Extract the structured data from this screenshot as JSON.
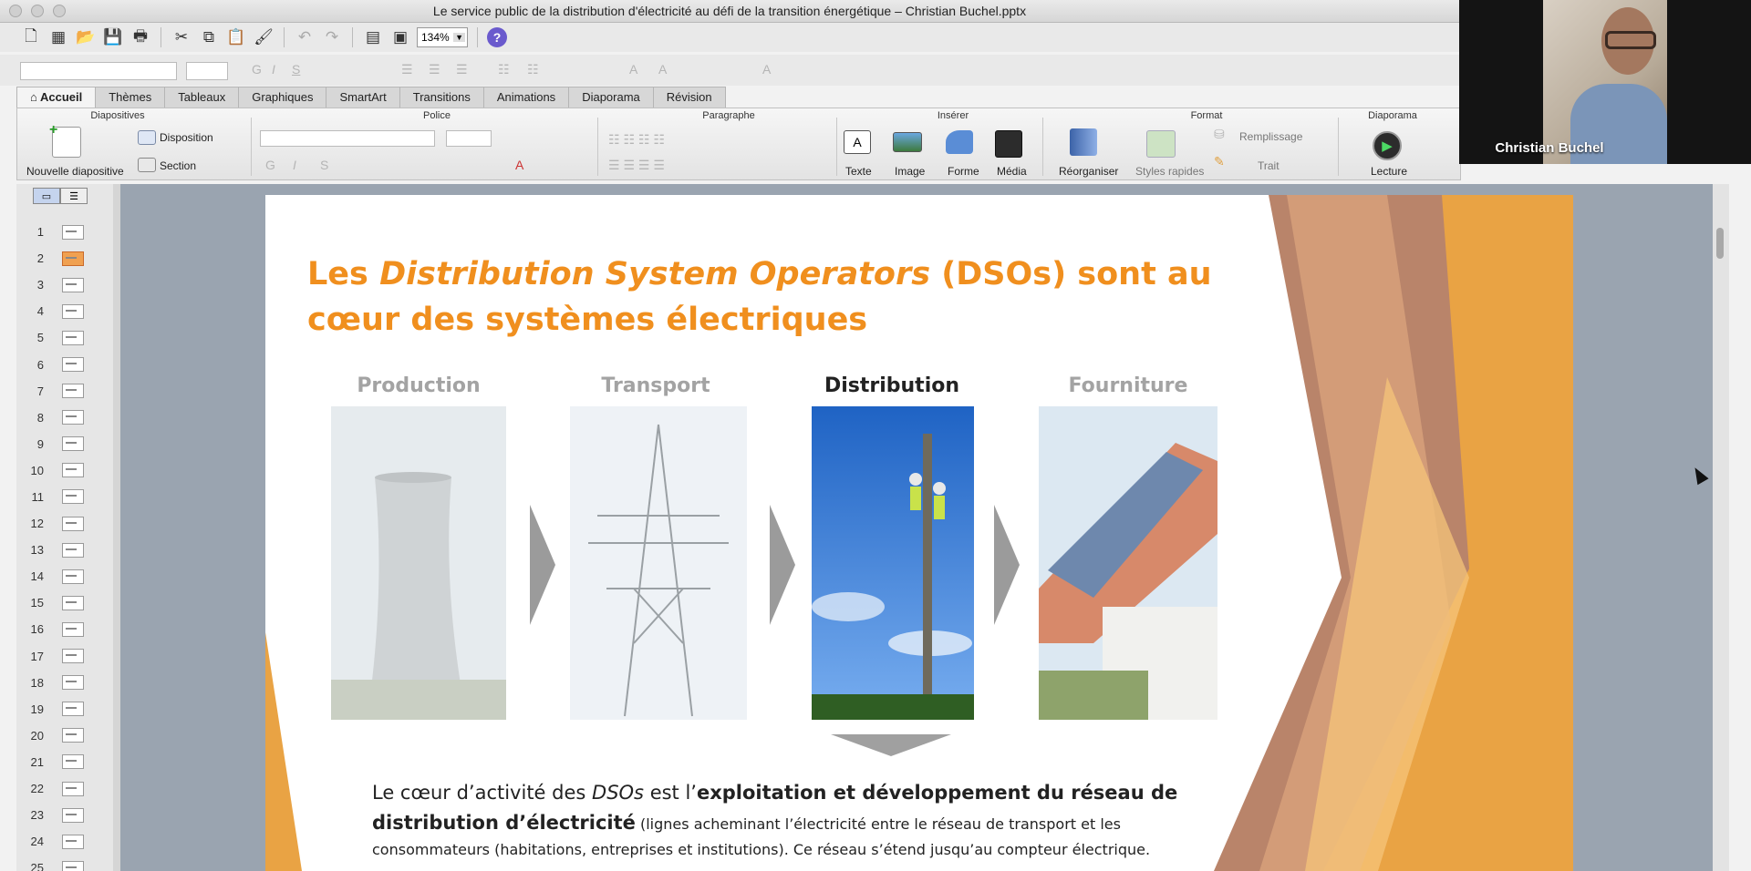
{
  "window": {
    "title": "Le service public de la distribution d'électricité au défi de la transition énergétique – Christian Buchel.pptx"
  },
  "toolbar": {
    "zoom": "134%"
  },
  "tabs": [
    {
      "label": "Accueil"
    },
    {
      "label": "Thèmes"
    },
    {
      "label": "Tableaux"
    },
    {
      "label": "Graphiques"
    },
    {
      "label": "SmartArt"
    },
    {
      "label": "Transitions"
    },
    {
      "label": "Animations"
    },
    {
      "label": "Diaporama"
    },
    {
      "label": "Révision"
    }
  ],
  "ribbon": {
    "groups": {
      "diapositives": "Diapositives",
      "police": "Police",
      "paragraphe": "Paragraphe",
      "inserer": "Insérer",
      "format": "Format",
      "diaporama": "Diaporama"
    },
    "nouvelle_diapositive": "Nouvelle diapositive",
    "disposition": "Disposition",
    "section": "Section",
    "texte": "Texte",
    "image": "Image",
    "forme": "Forme",
    "media": "Média",
    "reorganiser": "Réorganiser",
    "styles_rapides": "Styles rapides",
    "remplissage": "Remplissage",
    "trait": "Trait",
    "lecture": "Lecture"
  },
  "video": {
    "participant": "Christian Buchel"
  },
  "sidebar": {
    "slide_numbers": [
      "1",
      "2",
      "3",
      "4",
      "5",
      "6",
      "7",
      "8",
      "9",
      "10",
      "11",
      "12",
      "13",
      "14",
      "15",
      "16",
      "17",
      "18",
      "19",
      "20",
      "21",
      "22",
      "23",
      "24",
      "25"
    ],
    "selected": 2
  },
  "slide": {
    "title_a": "Les ",
    "title_em": "Distribution System Operators",
    "title_b": " (DSOs) sont au cœur des systèmes électriques",
    "stages": [
      "Production",
      "Transport",
      "Distribution",
      "Fourniture"
    ],
    "body_1": "Le cœur d’activité des ",
    "body_em": "DSOs",
    "body_2": " est l’",
    "body_bold": "exploitation et développement du réseau de distribution d’électricité",
    "body_small": " (lignes acheminant l’électricité entre le réseau de transport et les consommateurs (habitations, entreprises et institutions). Ce réseau s’étend jusqu’au compteur électrique."
  },
  "colors": {
    "accent": "#f08f1e",
    "tab_active": "#f4f4f4"
  }
}
